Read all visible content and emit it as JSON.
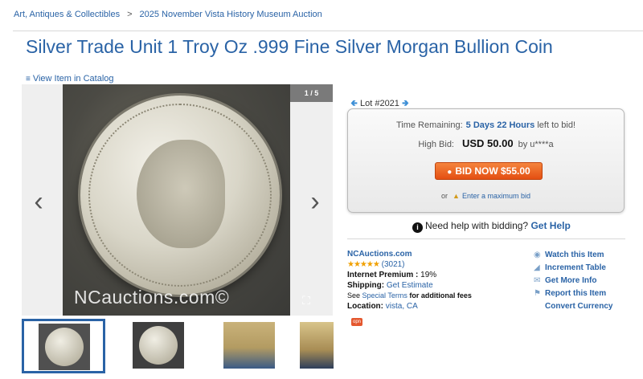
{
  "breadcrumb": {
    "items": [
      "Art, Antiques & Collectibles",
      "2025 November Vista History Museum Auction"
    ],
    "separator": ">"
  },
  "title": "Silver Trade Unit 1 Troy Oz .999 Fine Silver Morgan Bullion Coin",
  "catalog_link": "View Item in Catalog",
  "gallery": {
    "counter": "1 / 5",
    "watermark": "NCauctions.com©",
    "prev_icon": "chevron-left-icon",
    "next_icon": "chevron-right-icon",
    "expand_icon": "expand-icon"
  },
  "lot": {
    "label": "Lot #2021"
  },
  "bid": {
    "time_remaining_label": "Time Remaining:",
    "time_remaining_value": "5 Days 22 Hours",
    "time_remaining_suffix": "left to bid!",
    "high_bid_label": "High Bid:",
    "high_bid_amount": "USD 50.00",
    "high_bid_by": "by u****a",
    "button_label": "BID NOW $55.00",
    "or_text": "or",
    "max_bid_link": "Enter a maximum bid"
  },
  "help": {
    "text": "Need help with bidding?",
    "link": "Get Help"
  },
  "seller": {
    "name": "NCAuctions.com",
    "stars": "★★★★★",
    "rating_count": "(3021)",
    "premium_label": "Internet Premium :",
    "premium_value": "19%",
    "shipping_label": "Shipping:",
    "shipping_link": "Get Estimate",
    "see_text": "See",
    "special_terms_link": "Special Terms",
    "fees_text": "for additional fees",
    "location_label": "Location:",
    "location_value": "vista, CA",
    "badge": "opn"
  },
  "actions": [
    {
      "label": "Watch this Item",
      "icon": "eye-icon"
    },
    {
      "label": "Increment Table",
      "icon": "chart-icon"
    },
    {
      "label": "Get More Info",
      "icon": "mail-icon"
    },
    {
      "label": "Report this Item",
      "icon": "flag-icon"
    },
    {
      "label": "Convert Currency",
      "icon": ""
    }
  ],
  "colors": {
    "link": "#2a63a6",
    "bid_button": "#e4571a",
    "stars": "#f0a000"
  }
}
